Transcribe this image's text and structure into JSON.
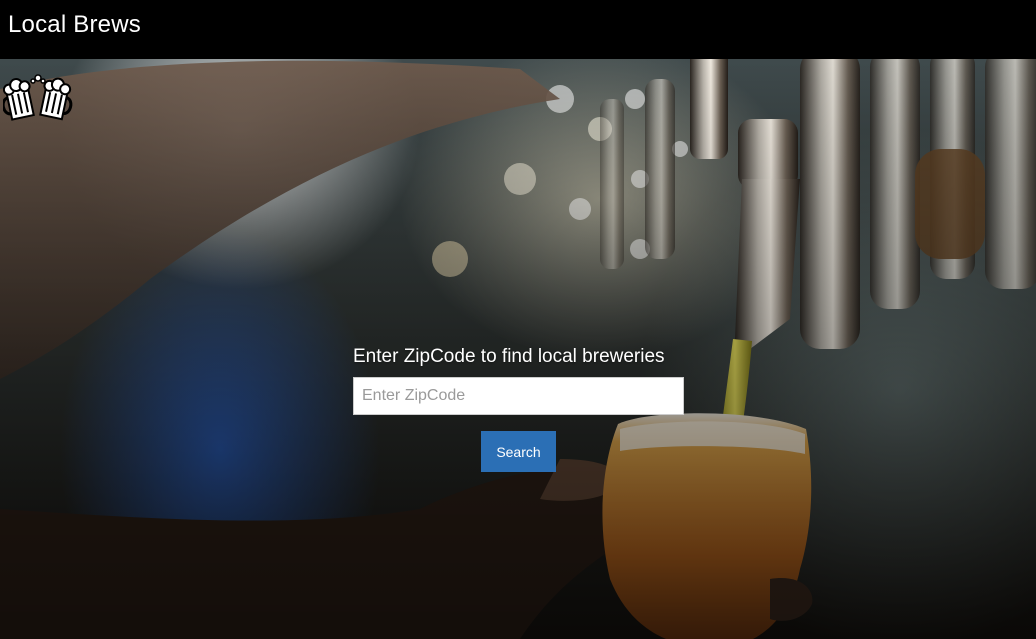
{
  "header": {
    "title": "Local Brews"
  },
  "logo": {
    "icon": "beer-mugs-cheers-icon"
  },
  "hero": {
    "background": "beer-tap-pouring-photo"
  },
  "search": {
    "label": "Enter ZipCode to find local breweries",
    "input_value": "",
    "input_placeholder": "Enter ZipCode",
    "button_label": "Search"
  },
  "colors": {
    "topbar": "#000000",
    "button": "#2b6fb5",
    "text": "#ffffff"
  }
}
